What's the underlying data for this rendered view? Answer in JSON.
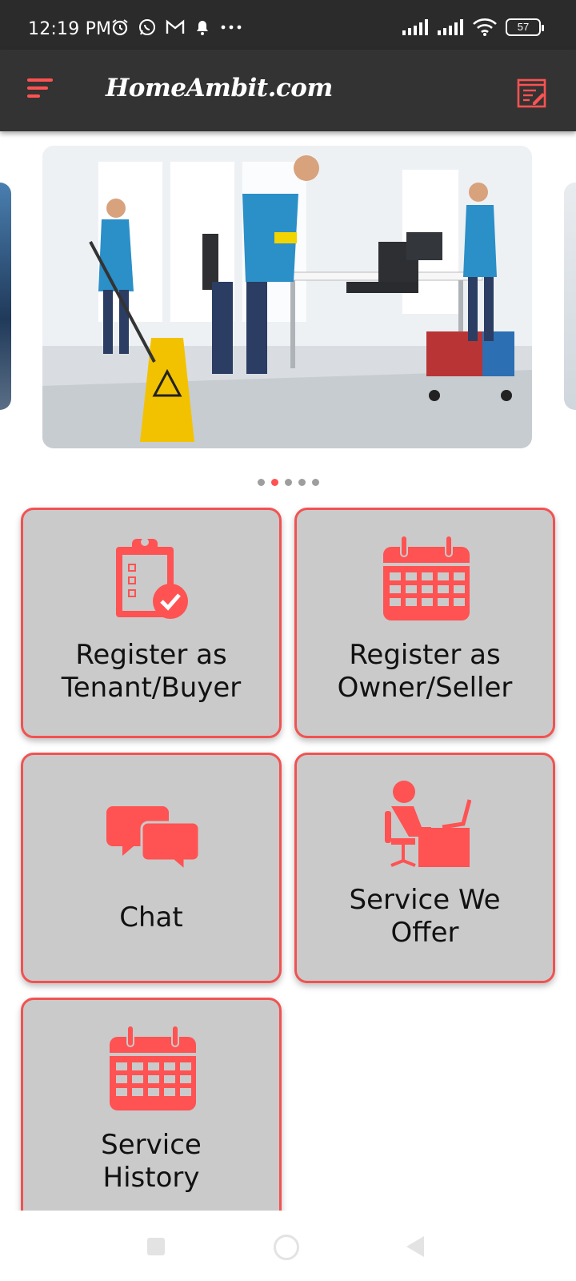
{
  "status_bar": {
    "time": "12:19 PM",
    "battery": "57",
    "icons_left": [
      "alarm-icon",
      "whatsapp-icon",
      "gmail-icon",
      "notification-bell-icon",
      "more-dots-icon"
    ],
    "icons_right": [
      "signal-icon",
      "signal-icon",
      "wifi-icon",
      "battery-icon"
    ]
  },
  "app_bar": {
    "title": "HomeAmbit.com",
    "menu_icon": "menu-icon",
    "action_icon": "notepad-edit-icon"
  },
  "carousel": {
    "slide_count": 5,
    "active_index": 1
  },
  "tiles": [
    {
      "icon": "clipboard-check-icon",
      "label_line1": "Register as",
      "label_line2": "Tenant/Buyer"
    },
    {
      "icon": "calendar-icon",
      "label_line1": "Register as",
      "label_line2": "Owner/Seller"
    },
    {
      "icon": "chat-bubbles-icon",
      "label_line1": "Chat",
      "label_line2": ""
    },
    {
      "icon": "person-at-desk-icon",
      "label_line1": "Service We",
      "label_line2": "Offer"
    },
    {
      "icon": "calendar-icon",
      "label_line1": "Service",
      "label_line2": "History"
    }
  ],
  "colors": {
    "accent": "#ff5252",
    "appbar": "#333333",
    "statusbar": "#2b2b2b",
    "tile_bg": "#cacaca",
    "tile_border": "#f25252"
  },
  "nav_bar": {
    "icons": [
      "recent-apps-icon",
      "home-icon",
      "back-icon"
    ]
  }
}
